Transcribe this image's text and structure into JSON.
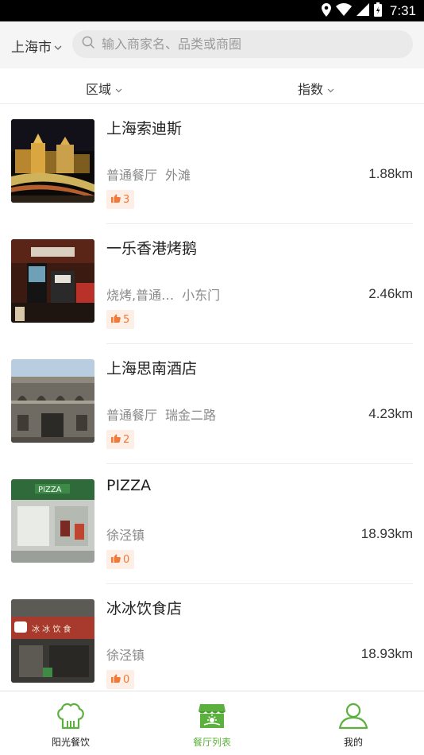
{
  "status_bar": {
    "time": "7:31"
  },
  "top_bar": {
    "city": "上海市",
    "search_placeholder": "输入商家名、品类或商圈"
  },
  "filters": [
    {
      "label": "区域"
    },
    {
      "label": "指数"
    }
  ],
  "restaurants": [
    {
      "name": "上海索迪斯",
      "category": "普通餐厅",
      "area": "外滩",
      "distance": "1.88km",
      "likes": "3"
    },
    {
      "name": "一乐香港烤鹅",
      "category": "烧烤,普通…",
      "area": "小东门",
      "distance": "2.46km",
      "likes": "5"
    },
    {
      "name": "上海思南酒店",
      "category": "普通餐厅",
      "area": "瑞金二路",
      "distance": "4.23km",
      "likes": "2"
    },
    {
      "name": "PIZZA",
      "category": "",
      "area": "徐泾镇",
      "distance": "18.93km",
      "likes": "0"
    },
    {
      "name": "冰冰饮食店",
      "category": "",
      "area": "徐泾镇",
      "distance": "18.93km",
      "likes": "0"
    }
  ],
  "tabs": [
    {
      "label": "阳光餐饮",
      "icon": "chef-hat-icon",
      "active": false
    },
    {
      "label": "餐厅列表",
      "icon": "storefront-icon",
      "active": true
    },
    {
      "label": "我的",
      "icon": "user-icon",
      "active": false
    }
  ],
  "colors": {
    "accent": "#5cb03d",
    "like": "#f07a3a"
  }
}
